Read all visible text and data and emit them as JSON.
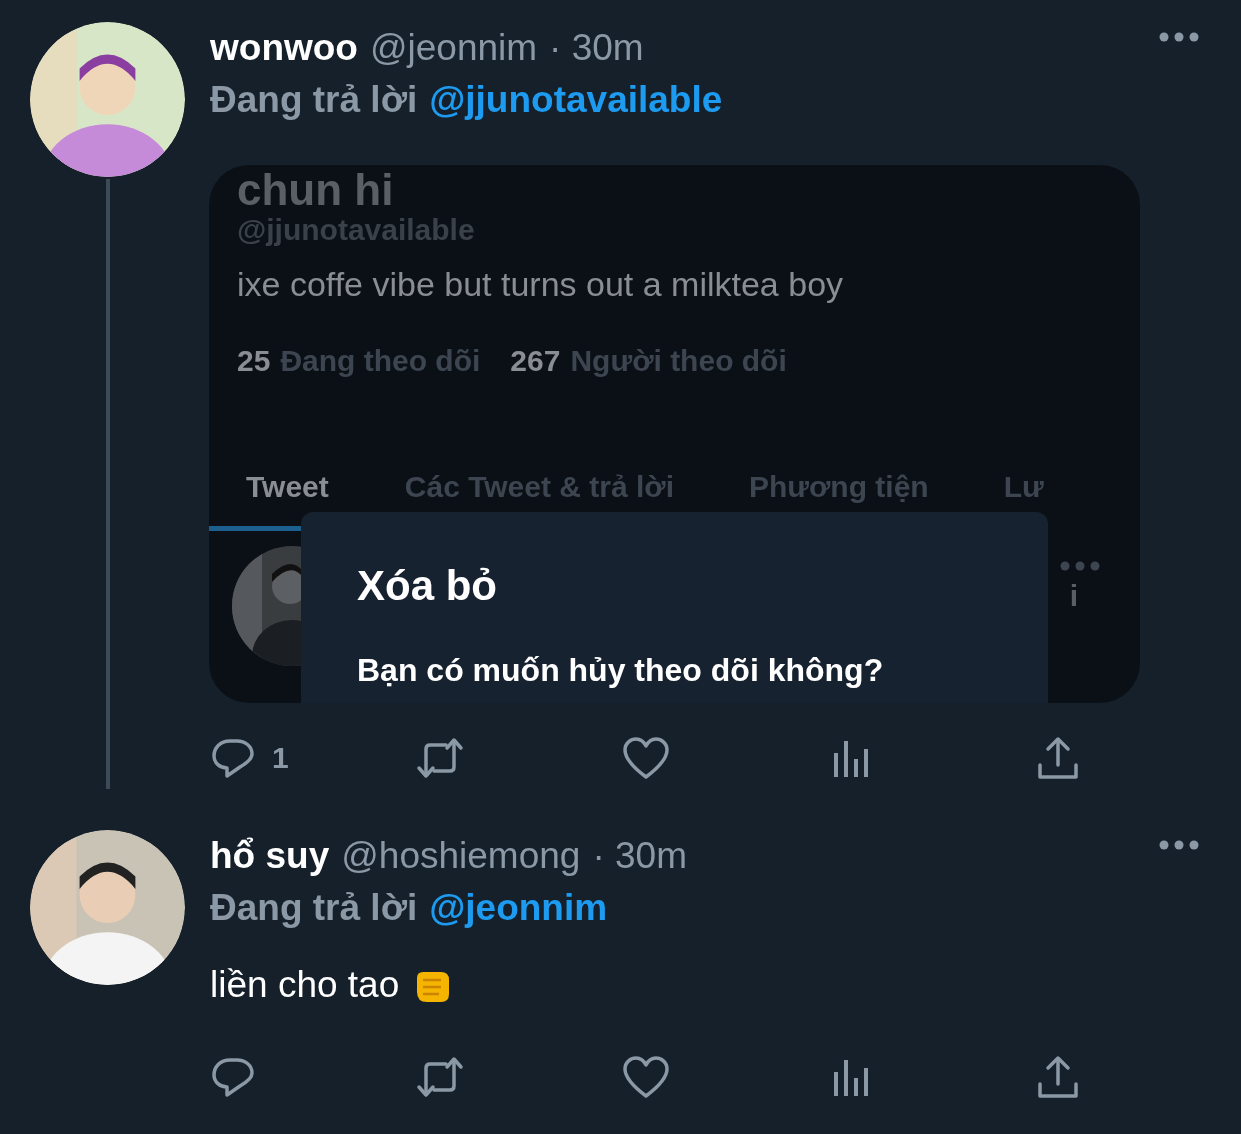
{
  "tweets": [
    {
      "name": "wonwoo",
      "handle": "@jeonnim",
      "time": "· 30m",
      "reply_label": "Đang trả lời",
      "reply_to": "@jjunotavailable",
      "thread_continues": true,
      "embed": {
        "display_name": "chun hi",
        "handle": "@jjunotavailable",
        "bio": "ixe coffe vibe but turns out a milktea boy",
        "stats": [
          {
            "count": "25",
            "label": "Đang theo dõi"
          },
          {
            "count": "267",
            "label": "Người theo dõi"
          }
        ],
        "tabs": [
          {
            "label": "Tweet",
            "selected": true
          },
          {
            "label": "Các Tweet & trả lời",
            "selected": false
          },
          {
            "label": "Phương tiện",
            "selected": false
          },
          {
            "label": "Lư",
            "selected": false
          }
        ],
        "inner_tweet_fragment": "i",
        "dialog": {
          "title": "Xóa bỏ",
          "message": "Bạn có muốn hủy theo dõi không?"
        }
      },
      "actions": [
        {
          "kind": "reply",
          "count": "1"
        },
        {
          "kind": "retweet"
        },
        {
          "kind": "like"
        },
        {
          "kind": "views"
        },
        {
          "kind": "share"
        }
      ]
    },
    {
      "name": "hổ suy",
      "handle": "@hoshiemong",
      "time": "· 30m",
      "reply_label": "Đang trả lời",
      "reply_to": "@jeonnim",
      "thread_continues": false,
      "text": "liền cho tao",
      "actions": [
        {
          "kind": "reply"
        },
        {
          "kind": "retweet"
        },
        {
          "kind": "like"
        },
        {
          "kind": "views"
        },
        {
          "kind": "share"
        }
      ]
    }
  ]
}
